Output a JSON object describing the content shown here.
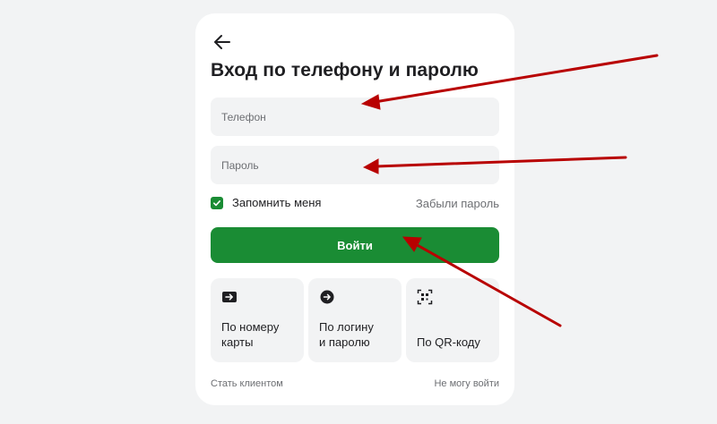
{
  "login": {
    "title": "Вход по телефону и паролю",
    "phone_placeholder": "Телефон",
    "password_placeholder": "Пароль",
    "remember_label": "Запомнить меня",
    "remember_checked": true,
    "forgot_label": "Забыли пароль",
    "submit_label": "Войти"
  },
  "methods": [
    {
      "label": "По номеру\nкарты",
      "icon": "arrow-right-box-icon"
    },
    {
      "label": "По логину\nи паролю",
      "icon": "arrow-right-circle-icon"
    },
    {
      "label": "По QR-коду",
      "icon": "qr-scan-icon"
    }
  ],
  "footer": {
    "left_label": "Стать клиентом",
    "right_label": "Не могу войти"
  },
  "colors": {
    "primary": "#1a8c34",
    "background": "#f2f3f4",
    "card": "#ffffff",
    "annotation": "#b80000"
  }
}
